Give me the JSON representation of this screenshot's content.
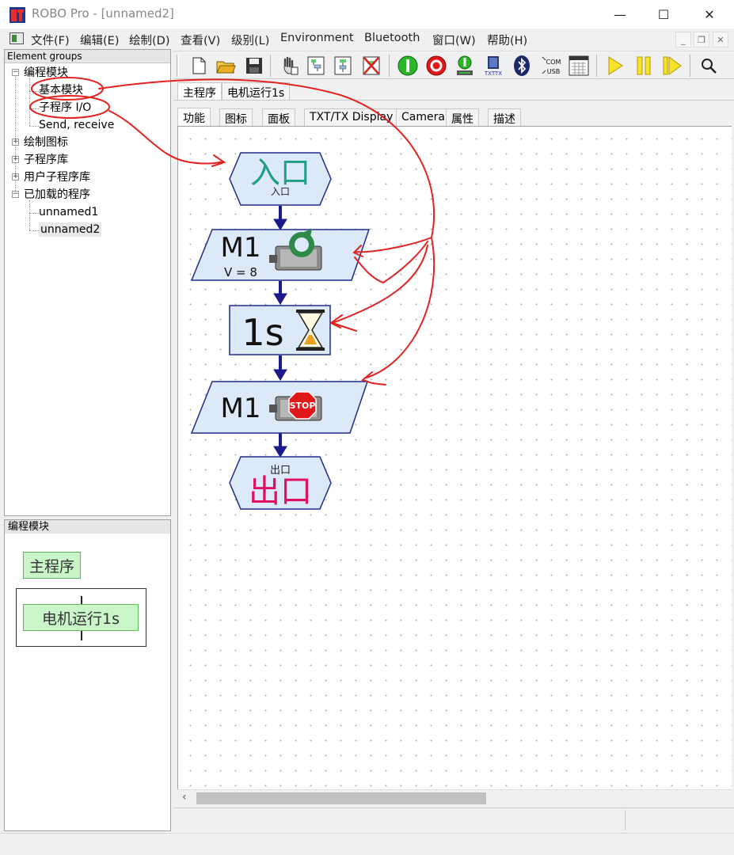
{
  "window": {
    "title": "ROBO Pro - [unnamed2]",
    "minimize": "—",
    "maximize": "☐",
    "close": "✕",
    "mdi_minimize": "_",
    "mdi_restore": "❐",
    "mdi_close": "✕"
  },
  "menu": [
    "文件(F)",
    "编辑(E)",
    "绘制(D)",
    "查看(V)",
    "级别(L)",
    "Environment",
    "Bluetooth",
    "窗口(W)",
    "帮助(H)"
  ],
  "element_groups": {
    "header": "Element groups",
    "items": [
      "编程模块",
      "基本模块",
      "子程序 I/O",
      "Send, receive",
      "绘制图标",
      "子程序库",
      "用户子程序库",
      "已加载的程序",
      "unnamed1",
      "unnamed2"
    ]
  },
  "blocks_pane": {
    "header": "编程模块",
    "main_program": "主程序",
    "subprogram": "电机运行1s"
  },
  "toolbar": {
    "buttons": [
      "new-file-icon",
      "open-folder-icon",
      "save-icon",
      "hand-tool-icon",
      "subprogram-icon",
      "subprogram-2-icon",
      "delete-icon",
      "start-green-icon",
      "stop-red-icon",
      "download-icon",
      "txt-tx-icon",
      "bluetooth-icon",
      "com-usb-icon",
      "panel-icon",
      "run-icon",
      "pause-icon",
      "step-icon",
      "zoom-icon"
    ],
    "txt_label": "TXTTX",
    "com_label": "COM",
    "usb_label": "USB"
  },
  "program_tabs": [
    "主程序",
    "电机运行1s"
  ],
  "view_tabs": [
    "功能",
    "图标",
    "面板",
    "TXT/TX Display",
    "Camera",
    "属性",
    "描述"
  ],
  "flowchart": {
    "entry": {
      "big": "入口",
      "small": "入口"
    },
    "motor_run": {
      "name": "M1",
      "speed": "V = 8"
    },
    "wait": {
      "time": "1s"
    },
    "motor_stop": {
      "name": "M1",
      "stop": "STOP"
    },
    "exit": {
      "big": "出口",
      "small": "出口"
    }
  },
  "colors": {
    "block_fill": "#dce9f8",
    "block_stroke": "#1e2a8a",
    "connector": "#1a1a8c",
    "entry_text": "#1fa085",
    "exit_text": "#e01060",
    "annotation": "#e32222"
  }
}
